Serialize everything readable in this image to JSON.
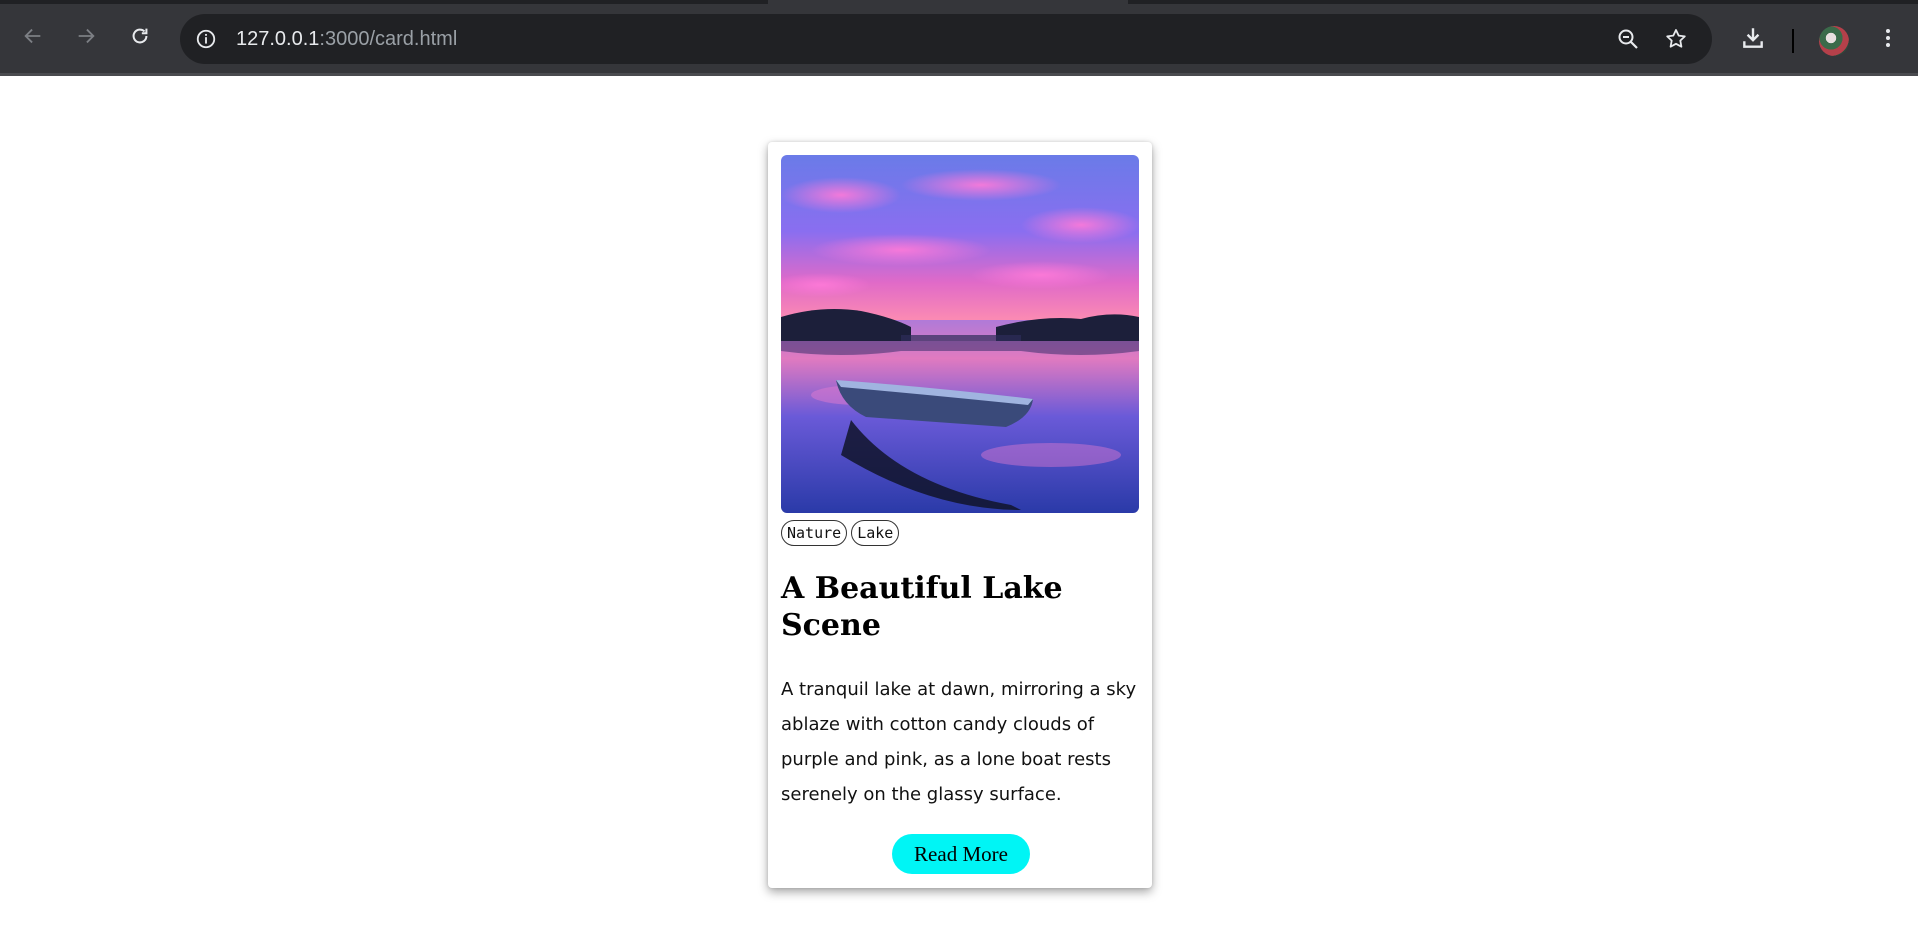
{
  "browser": {
    "url_host": "127.0.0.1",
    "url_path": ":3000/card.html"
  },
  "icons": {
    "back": "arrow-left-icon",
    "forward": "arrow-right-icon",
    "reload": "reload-icon",
    "site_info": "info-icon",
    "zoom": "zoom-out-icon",
    "bookmark": "star-icon",
    "downloads": "download-icon",
    "menu": "kebab-menu-icon"
  },
  "card": {
    "tags": [
      "Nature",
      "Lake"
    ],
    "title": "A Beautiful Lake Scene",
    "description": "A tranquil lake at dawn, mirroring a sky ablaze with cotton candy clouds of purple and pink, as a lone boat rests serenely on the glassy surface.",
    "button_label": "Read More"
  },
  "colors": {
    "chrome_bg": "#35363a",
    "omnibox_bg": "#202124",
    "button_accent": "#00f5f5"
  }
}
